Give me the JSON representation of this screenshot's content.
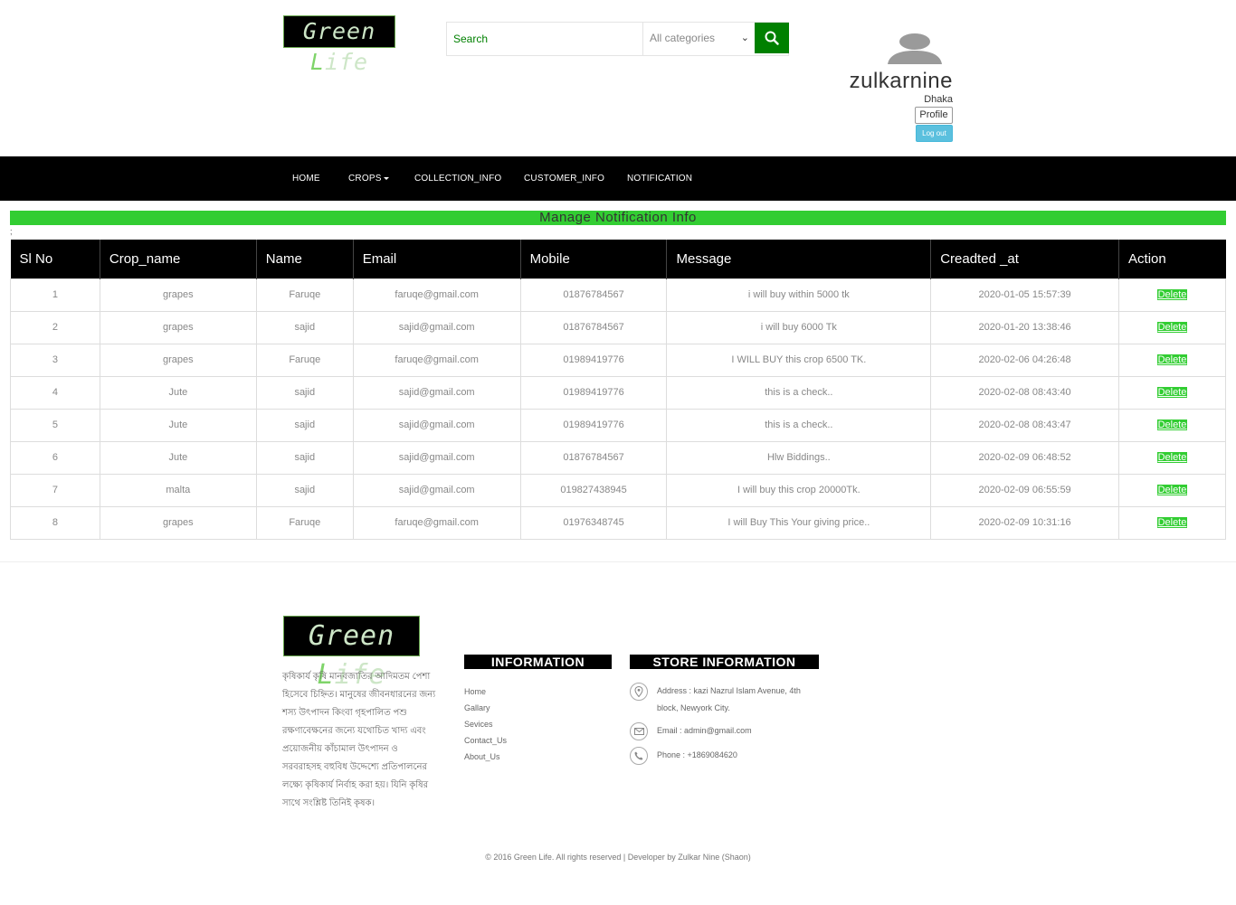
{
  "brand": {
    "logo_text_a": "Green ",
    "logo_text_b": "L",
    "logo_text_c": "ife"
  },
  "search": {
    "placeholder": "Search",
    "category": "All categories"
  },
  "user": {
    "name": "zulkarnine",
    "city": "Dhaka",
    "profile_label": "Profile",
    "logout_label": "Log out"
  },
  "nav": {
    "home": "HOME",
    "crops": "CROPS",
    "collection": "COLLECTION_INFO",
    "customer": "CUSTOMER_INFO",
    "notification": "NOTIFICATION"
  },
  "page": {
    "title": "Manage Notification Info",
    "stray": ";"
  },
  "table": {
    "headers": [
      "Sl No",
      "Crop_name",
      "Name",
      "Email",
      "Mobile",
      "Message",
      "Creadted _at",
      "Action"
    ],
    "rows": [
      {
        "sl": "1",
        "crop": "grapes",
        "name": "Faruqe",
        "email": "faruqe@gmail.com",
        "mobile": "01876784567",
        "message": "i will buy within 5000 tk",
        "created": "2020-01-05 15:57:39",
        "action": "Delete"
      },
      {
        "sl": "2",
        "crop": "grapes",
        "name": "sajid",
        "email": "sajid@gmail.com",
        "mobile": "01876784567",
        "message": "i will buy 6000 Tk",
        "created": "2020-01-20 13:38:46",
        "action": "Delete"
      },
      {
        "sl": "3",
        "crop": "grapes",
        "name": "Faruqe",
        "email": "faruqe@gmail.com",
        "mobile": "01989419776",
        "message": "I WILL BUY this crop 6500 TK.",
        "created": "2020-02-06 04:26:48",
        "action": "Delete"
      },
      {
        "sl": "4",
        "crop": "Jute",
        "name": "sajid",
        "email": "sajid@gmail.com",
        "mobile": "01989419776",
        "message": "this is a check..",
        "created": "2020-02-08 08:43:40",
        "action": "Delete"
      },
      {
        "sl": "5",
        "crop": "Jute",
        "name": "sajid",
        "email": "sajid@gmail.com",
        "mobile": "01989419776",
        "message": "this is a check..",
        "created": "2020-02-08 08:43:47",
        "action": "Delete"
      },
      {
        "sl": "6",
        "crop": "Jute",
        "name": "sajid",
        "email": "sajid@gmail.com",
        "mobile": "01876784567",
        "message": "Hlw Biddings..",
        "created": "2020-02-09 06:48:52",
        "action": "Delete"
      },
      {
        "sl": "7",
        "crop": "malta",
        "name": "sajid",
        "email": "sajid@gmail.com",
        "mobile": "019827438945",
        "message": "I will buy this crop 20000Tk.",
        "created": "2020-02-09 06:55:59",
        "action": "Delete"
      },
      {
        "sl": "8",
        "crop": "grapes",
        "name": "Faruqe",
        "email": "faruqe@gmail.com",
        "mobile": "01976348745",
        "message": "I will Buy This Your giving price..",
        "created": "2020-02-09 10:31:16",
        "action": "Delete"
      }
    ]
  },
  "footer": {
    "about": "কৃষিকার্য কৃষি মানবজাতির আদিমতম পেশা হিসেবে চিহ্নিত। মানুষের জীবনধারনের জন্য শস্য উৎপাদন কিংবা গৃহপালিত পশু রক্ষণাবেক্ষনের জন্যে যথোচিত খাদ্য এবং প্রয়োজনীয় কাঁচামাল উৎপাদন ও সরবরাহসহ বহুবিধ উদ্দেশ্যে প্রতিপালনের লক্ষ্যে কৃষিকার্য নির্বাহ করা হয়। যিনি কৃষির সাথে সংশ্লিষ্ট তিনিই কৃষক।",
    "info_heading": "INFORMATION",
    "info_links": [
      "Home",
      "Gallary",
      "Sevices",
      "Contact_Us",
      "About_Us"
    ],
    "store_heading": "STORE INFORMATION",
    "address": "Address : kazi Nazrul Islam Avenue, 4th block, Newyork City.",
    "email": "Email : admin@gmail.com",
    "phone": "Phone : +1869084620",
    "copyright": "© 2016 Green Life. All rights reserved | Developer by Zulkar Nine (Shaon)"
  },
  "colors": {
    "brand_green": "#008000",
    "title_bar": "#32cd32",
    "nav_bg": "#000000",
    "logout_bg": "#5bc0de"
  },
  "icons": [
    "search-icon",
    "chevron-down-icon",
    "avatar-icon",
    "caret-down-icon",
    "location-icon",
    "mail-icon",
    "phone-icon"
  ]
}
